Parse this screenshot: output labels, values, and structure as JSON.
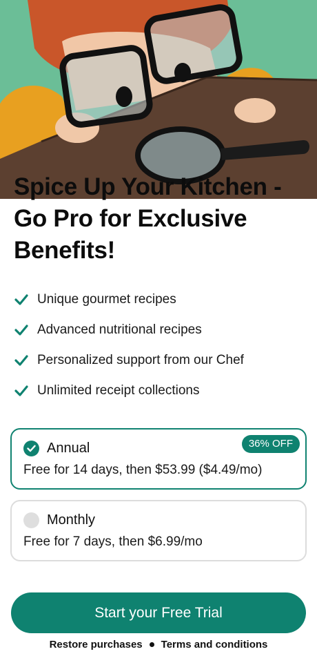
{
  "hero": {
    "image_description": "illustration"
  },
  "headline": "Spice Up Your Kitchen - Go Pro for Exclusive Benefits!",
  "features": [
    {
      "label": "Unique gourmet recipes"
    },
    {
      "label": "Advanced nutritional recipes"
    },
    {
      "label": "Personalized support from our Chef"
    },
    {
      "label": "Unlimited receipt collections"
    }
  ],
  "plans": {
    "annual": {
      "name": "Annual",
      "detail": "Free for 14 days, then $53.99 ($4.49/mo)",
      "badge": "36% OFF",
      "selected": true
    },
    "monthly": {
      "name": "Monthly",
      "detail": "Free for 7 days, then $6.99/mo",
      "selected": false
    }
  },
  "cta": {
    "label": "Start your Free Trial"
  },
  "footer": {
    "restore": "Restore purchases",
    "terms": "Terms and conditions"
  },
  "colors": {
    "accent": "#0f8270",
    "background": "#ffffff",
    "text": "#111111"
  }
}
